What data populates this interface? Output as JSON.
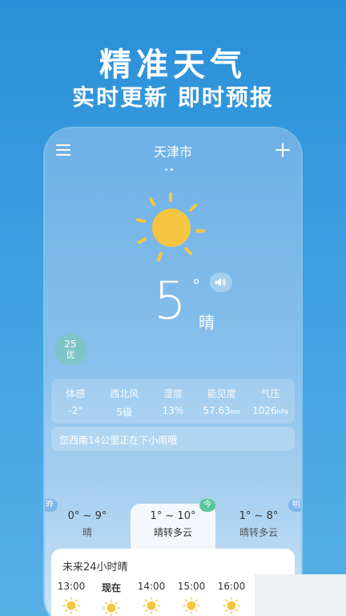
{
  "promo": {
    "headline": "精准天气",
    "subline": "实时更新 即时预报"
  },
  "header": {
    "city": "天津市",
    "menu_icon": "menu-icon",
    "add_icon": "add-icon"
  },
  "current": {
    "temperature": "5",
    "degree_symbol": "°",
    "condition": "晴",
    "sun_icon": "sun-icon",
    "speaker_icon": "speaker-icon"
  },
  "aqi": {
    "value": "25",
    "level": "优"
  },
  "stats": [
    {
      "label": "体感",
      "value": "-2°",
      "unit": ""
    },
    {
      "label": "西北风",
      "value": "5级",
      "unit": ""
    },
    {
      "label": "湿度",
      "value": "13%",
      "unit": ""
    },
    {
      "label": "能见度",
      "value": "57.63",
      "unit": "km"
    },
    {
      "label": "气压",
      "value": "1026",
      "unit": "hPa"
    }
  ],
  "notice": "您西南14公里正在下小雨哦",
  "days": [
    {
      "tag": "昨",
      "range": "0° ~ 9°",
      "desc": "晴"
    },
    {
      "tag": "今",
      "range": "1° ~ 10°",
      "desc": "晴转多云"
    },
    {
      "tag": "明",
      "range": "1° ~ 8°",
      "desc": "晴转多云"
    }
  ],
  "hourly": {
    "title": "未来24小时晴",
    "hours": [
      {
        "time": "13:00",
        "icon": "sun-icon"
      },
      {
        "time": "现在",
        "icon": "sun-icon"
      },
      {
        "time": "14:00",
        "icon": "sun-icon"
      },
      {
        "time": "15:00",
        "icon": "sun-icon"
      },
      {
        "time": "16:00",
        "icon": "sun-icon"
      }
    ]
  },
  "colors": {
    "background": "#2a8fd8",
    "sun": "#f6c643",
    "aqi_good": "#5cc79a"
  }
}
